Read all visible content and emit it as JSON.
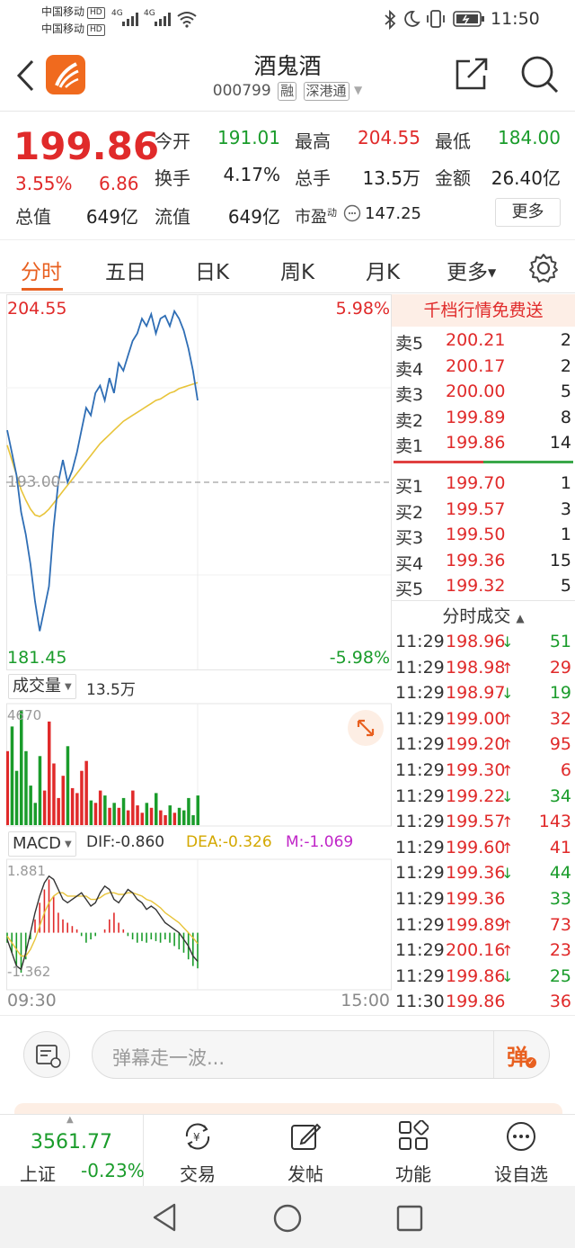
{
  "status_bar": {
    "carrier1": "中国移动",
    "carrier2": "中国移动",
    "hd": "HD",
    "sig1": "4G",
    "sig2": "4G",
    "time": "11:50"
  },
  "header": {
    "title": "酒鬼酒",
    "code": "000799",
    "tag_rong": "融",
    "tag_sgt": "深港通"
  },
  "quote": {
    "price": "199.86",
    "change_pct": "3.55%",
    "change": "6.86",
    "open_label": "今开",
    "open": "191.01",
    "high_label": "最高",
    "high": "204.55",
    "low_label": "最低",
    "low": "184.00",
    "turnover_label": "换手",
    "turnover": "4.17%",
    "volume_label": "总手",
    "volume": "13.5万",
    "amount_label": "金额",
    "amount": "26.40亿",
    "mktcap_label": "总值",
    "mktcap": "649亿",
    "float_label": "流值",
    "float": "649亿",
    "pe_label": "市盈",
    "pe_sup": "动",
    "pe_value": "147.25",
    "more_button": "更多"
  },
  "tabs": {
    "items": [
      "分时",
      "五日",
      "日K",
      "周K",
      "月K",
      "更多"
    ]
  },
  "chart": {
    "price_high_label": "204.55",
    "price_low_label": "181.45",
    "pct_high_label": "5.98%",
    "pct_low_label": "-5.98%",
    "prev_close_label": "193.00",
    "volume_selector": "成交量",
    "volume_total": "13.5万",
    "volume_max_label": "4670",
    "macd_selector": "MACD",
    "dif": "DIF:-0.860",
    "dea": "DEA:-0.326",
    "m": "M:-1.069",
    "macd_high_label": "1.881",
    "macd_low_label": "-1.362",
    "time_start": "09:30",
    "time_end": "15:00",
    "colors": {
      "price_line": "#2f6eb5",
      "avg_line": "#e8c43a",
      "up": "#e02a2a",
      "down": "#1a9c2b"
    }
  },
  "chart_data": {
    "type": "line",
    "series": [
      {
        "values": [
          196.5,
          195.0,
          193.5,
          191.0,
          189.5,
          187.5,
          185.0,
          183.0,
          184.5,
          186.0,
          190.0,
          193.0,
          194.5,
          193.0,
          193.8,
          195.0,
          196.5,
          198.0,
          197.5,
          199.0,
          199.5,
          198.5,
          200.0,
          199.0,
          201.0,
          200.5,
          201.5,
          202.5,
          203.0,
          204.0,
          203.5,
          204.3,
          203.0,
          204.0,
          204.2,
          203.5,
          204.5,
          204.0,
          203.2,
          202.0,
          200.5,
          198.5
        ],
        "avg_values": [
          195.5,
          194.5,
          193.5,
          192.5,
          191.8,
          191.2,
          190.8,
          190.7,
          190.9,
          191.2,
          191.6,
          192.0,
          192.4,
          192.8,
          193.2,
          193.6,
          194.0,
          194.4,
          194.8,
          195.2,
          195.6,
          195.9,
          196.2,
          196.5,
          196.8,
          197.1,
          197.3,
          197.5,
          197.7,
          197.9,
          198.1,
          198.3,
          198.5,
          198.6,
          198.8,
          199.0,
          199.1,
          199.3,
          199.4,
          199.5,
          199.6,
          199.7
        ]
      }
    ],
    "ylim": [
      181.45,
      204.55
    ],
    "volume_values": [
      3000,
      4000,
      2200,
      4670,
      3000,
      1600,
      900,
      2800,
      1400,
      4200,
      2500,
      1100,
      2000,
      3200,
      1500,
      1300,
      2200,
      2600,
      1000,
      900,
      1400,
      1200,
      700,
      900,
      700,
      1100,
      600,
      1400,
      800,
      500,
      900,
      700,
      1300,
      600,
      400,
      800,
      500,
      700,
      600,
      1100,
      400,
      1200
    ],
    "macd_values": [
      -0.3,
      -0.6,
      -1.0,
      -1.2,
      -0.8,
      -0.2,
      0.4,
      0.9,
      1.3,
      1.6,
      1.1,
      0.6,
      0.4,
      0.3,
      0.2,
      0.1,
      -0.1,
      -0.3,
      -0.2,
      -0.1,
      0.0,
      0.1,
      0.4,
      0.6,
      0.3,
      0.1,
      -0.1,
      -0.2,
      -0.3,
      -0.25,
      -0.3,
      -0.2,
      -0.25,
      -0.3,
      -0.2,
      -0.3,
      -0.4,
      -0.5,
      -0.6,
      -0.8,
      -1.0,
      -1.069
    ],
    "dif_values": [
      -0.2,
      -0.6,
      -1.0,
      -1.1,
      -0.6,
      0.0,
      0.6,
      1.1,
      1.5,
      1.7,
      1.6,
      1.3,
      1.0,
      0.9,
      1.0,
      1.1,
      1.2,
      1.0,
      0.8,
      0.9,
      1.2,
      1.4,
      1.3,
      1.0,
      0.9,
      1.1,
      1.3,
      1.2,
      1.0,
      0.9,
      0.7,
      0.8,
      0.7,
      0.5,
      0.3,
      0.2,
      0.1,
      0.0,
      -0.2,
      -0.4,
      -0.7,
      -0.86
    ],
    "dea_values": [
      -0.1,
      -0.3,
      -0.5,
      -0.7,
      -0.7,
      -0.5,
      -0.2,
      0.2,
      0.6,
      0.9,
      1.1,
      1.2,
      1.2,
      1.1,
      1.1,
      1.1,
      1.1,
      1.1,
      1.0,
      1.0,
      1.05,
      1.15,
      1.2,
      1.2,
      1.15,
      1.15,
      1.2,
      1.2,
      1.15,
      1.1,
      1.0,
      0.95,
      0.85,
      0.75,
      0.6,
      0.5,
      0.4,
      0.3,
      0.15,
      0.0,
      -0.15,
      -0.326
    ]
  },
  "order_book": {
    "banner": "千档行情免费送",
    "asks": [
      {
        "label": "卖5",
        "price": "200.21",
        "qty": "2"
      },
      {
        "label": "卖4",
        "price": "200.17",
        "qty": "2"
      },
      {
        "label": "卖3",
        "price": "200.00",
        "qty": "5"
      },
      {
        "label": "卖2",
        "price": "199.89",
        "qty": "8"
      },
      {
        "label": "卖1",
        "price": "199.86",
        "qty": "14"
      }
    ],
    "bids": [
      {
        "label": "买1",
        "price": "199.70",
        "qty": "1"
      },
      {
        "label": "买2",
        "price": "199.57",
        "qty": "3"
      },
      {
        "label": "买3",
        "price": "199.50",
        "qty": "1"
      },
      {
        "label": "买4",
        "price": "199.36",
        "qty": "15"
      },
      {
        "label": "买5",
        "price": "199.32",
        "qty": "5"
      }
    ],
    "trades_header": "分时成交",
    "trades": [
      {
        "time": "11:29",
        "price": "198.96",
        "dir": "↓",
        "qty": "51",
        "color": "green"
      },
      {
        "time": "11:29",
        "price": "198.98",
        "dir": "↑",
        "qty": "29",
        "color": "red"
      },
      {
        "time": "11:29",
        "price": "198.97",
        "dir": "↓",
        "qty": "19",
        "color": "green"
      },
      {
        "time": "11:29",
        "price": "199.00",
        "dir": "↑",
        "qty": "32",
        "color": "red"
      },
      {
        "time": "11:29",
        "price": "199.20",
        "dir": "↑",
        "qty": "95",
        "color": "red"
      },
      {
        "time": "11:29",
        "price": "199.30",
        "dir": "↑",
        "qty": "6",
        "color": "red"
      },
      {
        "time": "11:29",
        "price": "199.22",
        "dir": "↓",
        "qty": "34",
        "color": "green"
      },
      {
        "time": "11:29",
        "price": "199.57",
        "dir": "↑",
        "qty": "143",
        "color": "red"
      },
      {
        "time": "11:29",
        "price": "199.60",
        "dir": "↑",
        "qty": "41",
        "color": "red"
      },
      {
        "time": "11:29",
        "price": "199.36",
        "dir": "↓",
        "qty": "44",
        "color": "green"
      },
      {
        "time": "11:29",
        "price": "199.36",
        "dir": "",
        "qty": "33",
        "color": "green"
      },
      {
        "time": "11:29",
        "price": "199.89",
        "dir": "↑",
        "qty": "73",
        "color": "red"
      },
      {
        "time": "11:29",
        "price": "200.16",
        "dir": "↑",
        "qty": "23",
        "color": "red"
      },
      {
        "time": "11:29",
        "price": "199.86",
        "dir": "↓",
        "qty": "25",
        "color": "green"
      },
      {
        "time": "11:30",
        "price": "199.86",
        "dir": "",
        "qty": "36",
        "color": "red"
      }
    ]
  },
  "comment": {
    "placeholder": "弹幕走一波...",
    "danmu_button": "弹"
  },
  "bottom_nav": {
    "index_value": "3561.77",
    "index_name": "上证",
    "index_change": "-0.23%",
    "items": [
      "交易",
      "发帖",
      "功能",
      "设自选"
    ]
  }
}
